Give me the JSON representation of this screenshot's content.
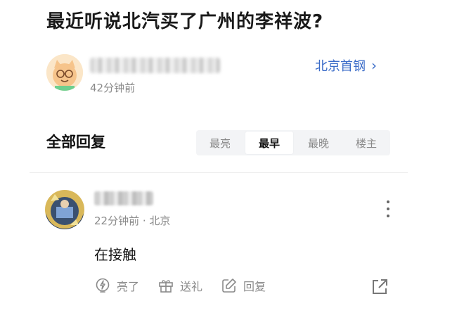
{
  "post": {
    "title": "最近听说北汽买了广州的李祥波?",
    "author": {
      "name_blurred": true,
      "time": "42分钟前"
    },
    "forum_link": {
      "label": "北京首钢",
      "chevron": "›"
    }
  },
  "replies_section": {
    "title": "全部回复",
    "sort_tabs": [
      {
        "label": "最亮",
        "active": false
      },
      {
        "label": "最早",
        "active": true
      },
      {
        "label": "最晚",
        "active": false
      },
      {
        "label": "楼主",
        "active": false
      }
    ]
  },
  "reply": {
    "user_blurred": true,
    "time": "22分钟前",
    "location": "北京",
    "meta": "22分钟前 · 北京",
    "content": "在接触",
    "actions": [
      {
        "label": "亮了",
        "icon": "lightning-icon"
      },
      {
        "label": "送礼",
        "icon": "gift-icon"
      },
      {
        "label": "回复",
        "icon": "edit-reply-icon"
      }
    ],
    "share_icon": "share-icon",
    "more_icon": "more-vertical-icon"
  },
  "colors": {
    "link": "#3b6cc8",
    "muted": "#8a8a8a",
    "text": "#222222"
  }
}
